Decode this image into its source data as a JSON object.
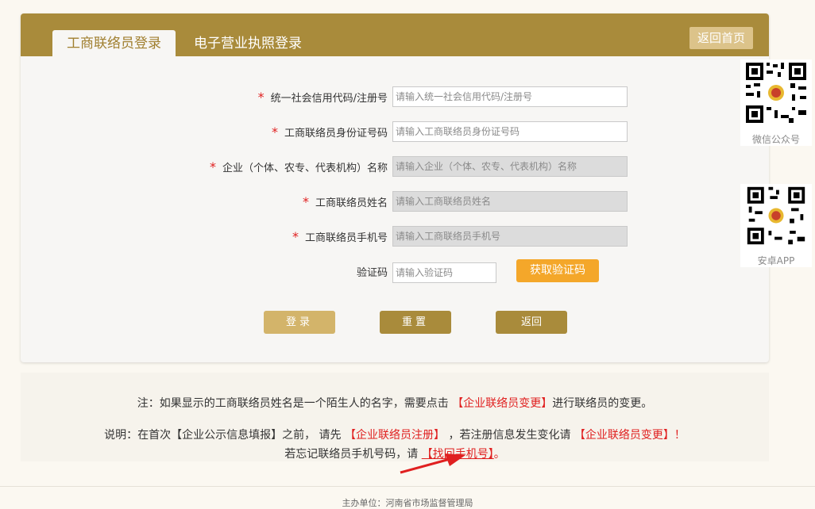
{
  "tabs": {
    "active_label": "工商联络员登录",
    "other_label": "电子营业执照登录",
    "home_label": "返回首页"
  },
  "form": {
    "fields": [
      {
        "label": "统一社会信用代码/注册号",
        "placeholder": "请输入统一社会信用代码/注册号",
        "required": "*"
      },
      {
        "label": "工商联络员身份证号码",
        "placeholder": "请输入工商联络员身份证号码",
        "required": "*"
      },
      {
        "label": "企业（个体、农专、代表机构）名称",
        "placeholder": "请输入企业（个体、农专、代表机构）名称",
        "required": "*"
      },
      {
        "label": "工商联络员姓名",
        "placeholder": "请输入工商联络员姓名",
        "required": "*"
      },
      {
        "label": "工商联络员手机号",
        "placeholder": "请输入工商联络员手机号",
        "required": "*"
      }
    ],
    "captcha_label": "验证码",
    "captcha_placeholder": "请输入验证码",
    "captcha_button": "获取验证码"
  },
  "buttons": {
    "login": "登录",
    "reset": "重置",
    "back": "返回"
  },
  "notes": {
    "line1_pre": "注：如果显示的工商联络员姓名是一个陌生人的名字，需要点击",
    "line1_link": "【企业联络员变更】",
    "line1_post": "进行联络员的变更。",
    "line2_pre": "说明：在首次【企业公示信息填报】之前， 请先",
    "line2_link1": "【企业联络员注册】",
    "line2_mid": "，若注册信息发生变化请",
    "line2_link2": "【企业联络员变更】！",
    "line3_pre": "若忘记联络员手机号码，请",
    "line3_link": "【找回手机号】",
    "line3_post": "。"
  },
  "sidebar": {
    "wechat_caption": "微信公众号",
    "android_caption": "安卓APP"
  },
  "footer": {
    "text": "主办单位：河南省市场监督管理局"
  },
  "colors": {
    "brand": "#a98b3b",
    "accent_orange": "#f4a72a",
    "link_red": "#e02020"
  }
}
